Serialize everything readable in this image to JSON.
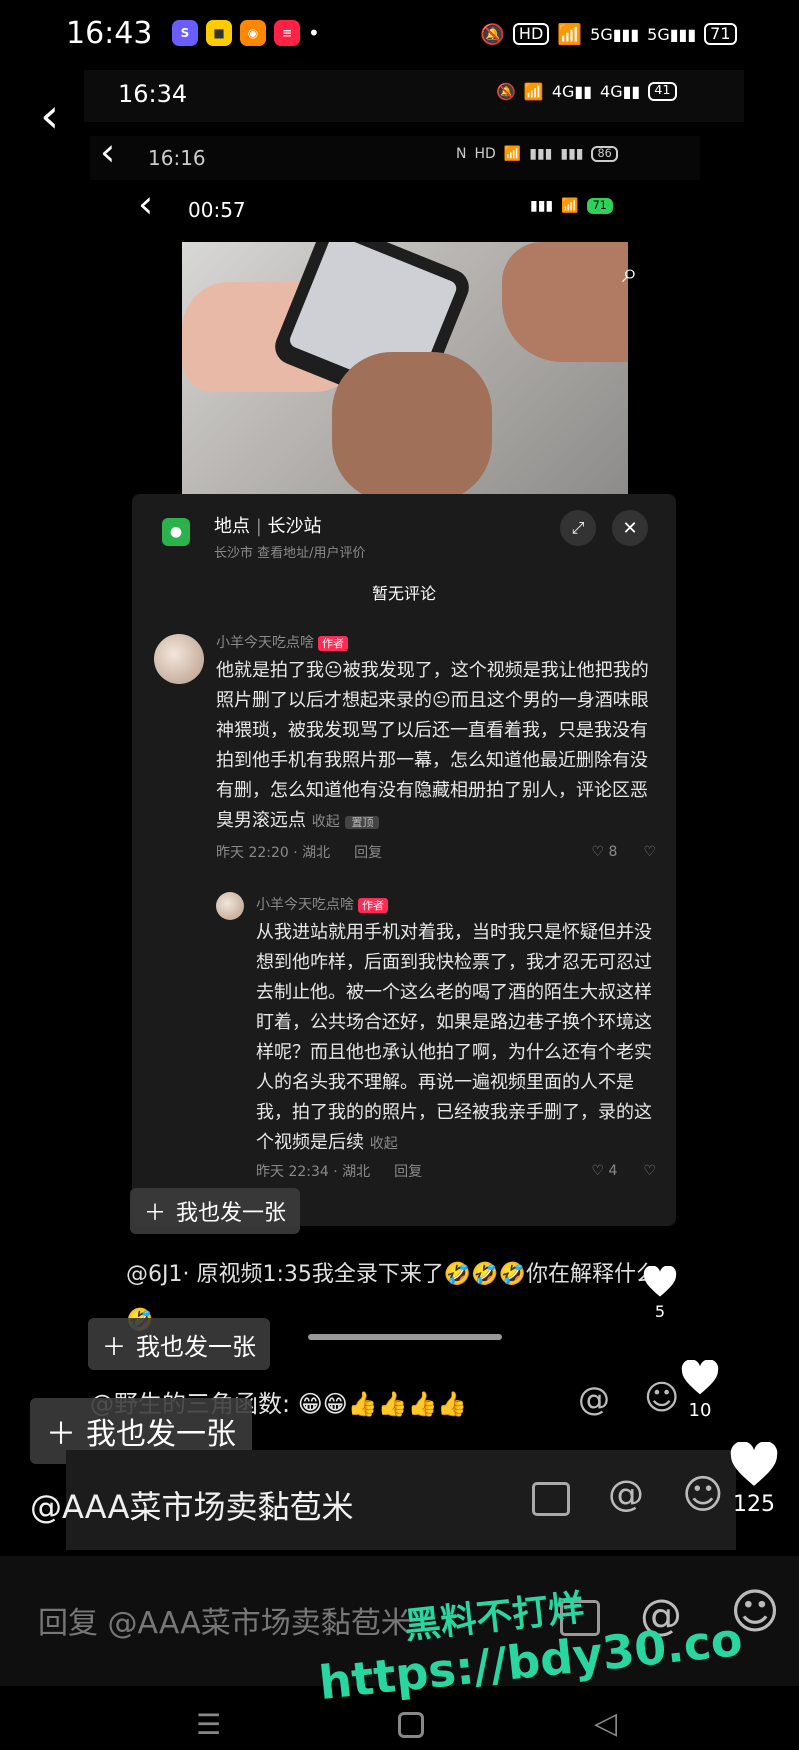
{
  "status1": {
    "time": "16:43",
    "battery": "71",
    "hd": "HD",
    "net1": "5G",
    "net2": "5G"
  },
  "app_icons": [
    {
      "name": "app-icon-1",
      "color": "#6a5cff",
      "text": "S"
    },
    {
      "name": "app-icon-2",
      "color": "#ffcc00",
      "text": "■"
    },
    {
      "name": "app-icon-3",
      "color": "#ff8800",
      "text": "◉"
    },
    {
      "name": "app-icon-4",
      "color": "#ff2244",
      "text": "≡"
    }
  ],
  "status2": {
    "time": "16:34",
    "battery": "41",
    "net1": "4G",
    "net2": "4G"
  },
  "status3": {
    "time": "16:16",
    "battery": "86"
  },
  "status4": {
    "time": "00:57",
    "battery": "71"
  },
  "location": {
    "label": "地点",
    "name": "长沙站",
    "sub": "长沙市  查看地址/用户评价"
  },
  "no_comments": "暂无评论",
  "comment1": {
    "user": "小羊今天吃点啥",
    "tag": "作者",
    "text": "他就是拍了我😐被我发现了，这个视频是我让他把我的照片删了以后才想起来录的😐而且这个男的一身酒味眼神猥琐，被我发现骂了以后还一直看着我，只是我没有拍到他手机有我照片那一幕，怎么知道他最近删除有没有删，怎么知道他有没有隐藏相册拍了别人，评论区恶臭男滚远点",
    "collapse": "收起",
    "translate": "置顶",
    "time": "昨天 22:20 · 湖北",
    "reply": "回复",
    "likes": "8"
  },
  "comment2": {
    "user": "小羊今天吃点啥",
    "tag": "作者",
    "text": "从我进站就用手机对着我，当时我只是怀疑但并没想到他咋样，后面到我快检票了，我才忍无可忍过去制止他。被一个这么老的喝了酒的陌生大叔这样盯着，公共场合还好，如果是路边巷子换个环境这样呢？而且他也承认他拍了啊，为什么还有个老实人的名头我不理解。再说一遍视频里面的人不是我，拍了我的的照片，已经被我亲手删了，录的这个视频是后续",
    "collapse": "收起",
    "time": "昨天 22:34 · 湖北",
    "reply": "回复",
    "likes": "4"
  },
  "repost_label": "我也发一张",
  "comment3": {
    "text": "@6J1·  原视频1:35我全录下来了🤣🤣🤣你在解释什么🤣",
    "likes": "5"
  },
  "comment4": {
    "text": "@野生的三角函数: 😁😁👍👍👍👍",
    "likes": "10"
  },
  "comment5": {
    "text": "@AAA菜市场卖黏苞米",
    "likes": "125"
  },
  "reply_box": {
    "placeholder": "回复 @AAA菜市场卖黏苞米"
  },
  "watermark": {
    "line1": "黑料不打烊",
    "line2": "https://bdy30.co"
  },
  "colors": {
    "accent": "#ff2b55",
    "watermark": "#2ad6a0",
    "panel": "#1b1b1b"
  }
}
